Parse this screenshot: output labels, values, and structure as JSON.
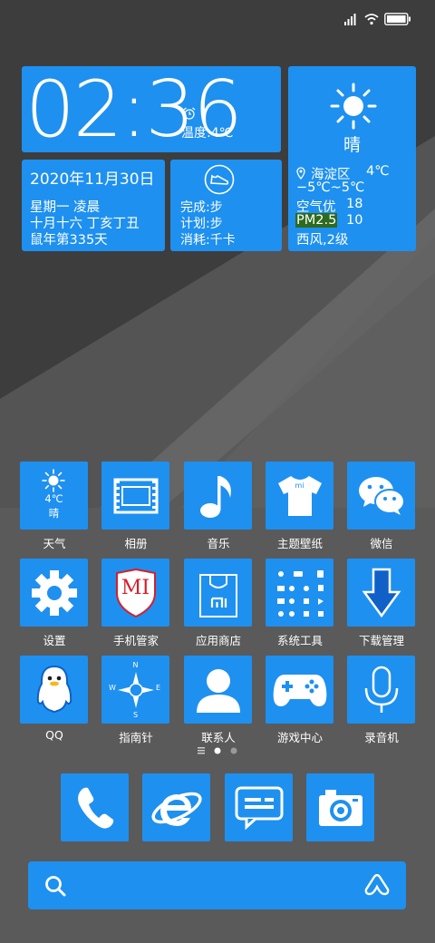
{
  "clock": {
    "time": "02:36",
    "temp_label": "温度:4℃"
  },
  "weather_widget": {
    "condition": "晴",
    "location": "海淀区",
    "temp": "4℃",
    "range": "−5℃~5℃",
    "air_label": "空气优",
    "air_value": "18",
    "pm_label": "PM2.5",
    "pm_value": "10",
    "wind": "西风,2级"
  },
  "date_widget": {
    "date": "2020年11月30日",
    "weekday_time": "星期一  凌晨",
    "lunar": "十月十六  丁亥丁丑",
    "year_day": "鼠年第335天"
  },
  "step_widget": {
    "done": "完成:步",
    "plan": "计划:步",
    "burn": "消耗:千卡"
  },
  "apps": [
    {
      "label": "天气",
      "icon": "weather-icon",
      "temp": "4℃",
      "cond": "晴"
    },
    {
      "label": "相册",
      "icon": "film-icon"
    },
    {
      "label": "音乐",
      "icon": "music-note-icon"
    },
    {
      "label": "主题壁纸",
      "icon": "tshirt-icon",
      "badge": "mi"
    },
    {
      "label": "微信",
      "icon": "wechat-icon"
    },
    {
      "label": "设置",
      "icon": "gear-icon"
    },
    {
      "label": "手机管家",
      "icon": "shield-icon",
      "badge": "MI"
    },
    {
      "label": "应用商店",
      "icon": "shopping-bag-icon"
    },
    {
      "label": "系统工具",
      "icon": "tools-grid-icon"
    },
    {
      "label": "下载管理",
      "icon": "download-arrow-icon"
    },
    {
      "label": "QQ",
      "icon": "qq-penguin-icon"
    },
    {
      "label": "指南针",
      "icon": "compass-icon",
      "n": "N",
      "s": "S",
      "w": "W",
      "e": "E"
    },
    {
      "label": "联系人",
      "icon": "contact-person-icon"
    },
    {
      "label": "游戏中心",
      "icon": "gamepad-icon"
    },
    {
      "label": "录音机",
      "icon": "microphone-icon"
    }
  ],
  "dock": [
    {
      "icon": "phone-icon"
    },
    {
      "icon": "browser-e-icon"
    },
    {
      "icon": "message-icon"
    },
    {
      "icon": "camera-icon"
    }
  ],
  "search": {
    "icon": "search-icon",
    "assistant_icon": "assistant-icon"
  },
  "colors": {
    "tile": "#1e90f0",
    "bg_dark": "#3c3c3c",
    "bg": "#5c5c5c",
    "pm_bg": "#2e6b1e"
  }
}
